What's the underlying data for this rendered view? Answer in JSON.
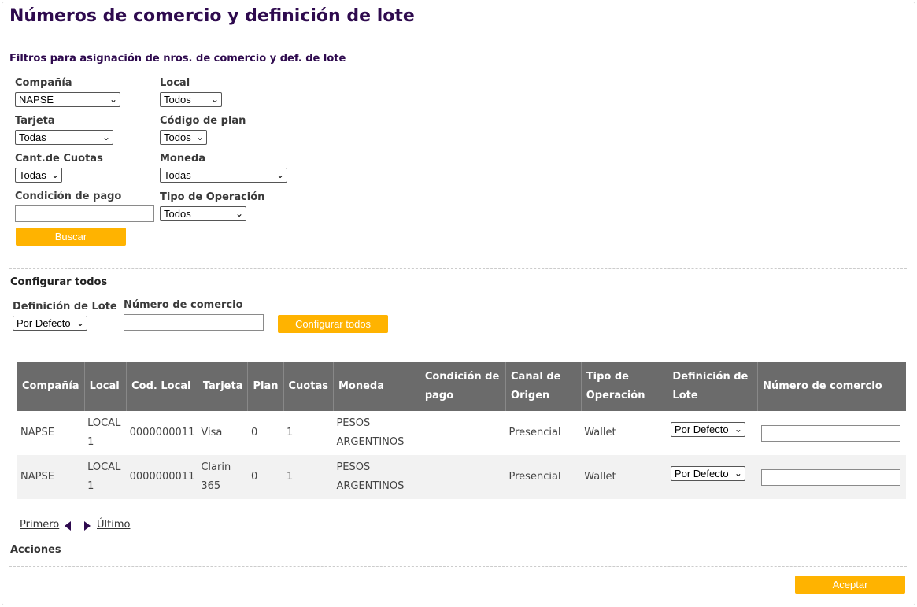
{
  "page": {
    "title": "Números de comercio y definición de lote"
  },
  "filters": {
    "title": "Filtros para asignación de nros. de comercio y def. de lote",
    "compania": {
      "label": "Compañía",
      "value": "NAPSE"
    },
    "local": {
      "label": "Local",
      "value": "Todos"
    },
    "tarjeta": {
      "label": "Tarjeta",
      "value": "Todas"
    },
    "codigo_plan": {
      "label": "Código de plan",
      "value": "Todos"
    },
    "cant_cuotas": {
      "label": "Cant.de Cuotas",
      "value": "Todas"
    },
    "moneda": {
      "label": "Moneda",
      "value": "Todas"
    },
    "condicion_pago": {
      "label": "Condición de pago",
      "value": ""
    },
    "tipo_operacion": {
      "label": "Tipo de Operación",
      "value": "Todos"
    },
    "search_button": "Buscar"
  },
  "configure_all": {
    "title": "Configurar todos",
    "definicion_lote": {
      "label": "Definición de Lote",
      "value": "Por Defecto"
    },
    "numero_comercio": {
      "label": "Número de comercio",
      "value": ""
    },
    "button": "Configurar todos"
  },
  "table": {
    "columns": [
      "Compañía",
      "Local",
      "Cod. Local",
      "Tarjeta",
      "Plan",
      "Cuotas",
      "Moneda",
      "Condición de pago",
      "Canal de Origen",
      "Tipo de Operación",
      "Definición de Lote",
      "Número de comercio"
    ],
    "rows": [
      {
        "compania": "NAPSE",
        "local": "LOCAL 1",
        "cod_local": "0000000011",
        "tarjeta": "Visa",
        "plan": "0",
        "cuotas": "1",
        "moneda": "PESOS ARGENTINOS",
        "condicion": "",
        "canal": "Presencial",
        "tipo_operacion": "Wallet",
        "definicion_lote": "Por Defecto",
        "numero_comercio": ""
      },
      {
        "compania": "NAPSE",
        "local": "LOCAL 1",
        "cod_local": "0000000011",
        "tarjeta": "Clarin 365",
        "plan": "0",
        "cuotas": "1",
        "moneda": "PESOS ARGENTINOS",
        "condicion": "",
        "canal": "Presencial",
        "tipo_operacion": "Wallet",
        "definicion_lote": "Por Defecto",
        "numero_comercio": ""
      }
    ]
  },
  "pager": {
    "first": "Primero",
    "last": "Último"
  },
  "actions": {
    "title": "Acciones",
    "accept": "Aceptar"
  },
  "colors": {
    "accent": "#ffb300",
    "title": "#2e0a4e",
    "header_bg": "#6b6b6b"
  }
}
